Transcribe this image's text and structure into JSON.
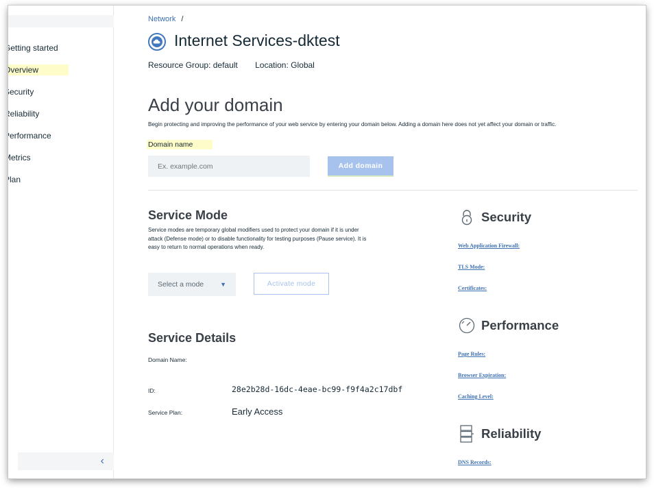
{
  "sidebar": {
    "items": [
      {
        "label": "Getting started"
      },
      {
        "label": "Overview"
      },
      {
        "label": "Security"
      },
      {
        "label": "Reliability"
      },
      {
        "label": "Performance"
      },
      {
        "label": "Metrics"
      },
      {
        "label": "Plan"
      }
    ],
    "active_index": 1,
    "collapse_glyph": "‹"
  },
  "breadcrumb": {
    "parent": "Network",
    "separator": "/"
  },
  "header": {
    "icon": "cloud-icon",
    "title": "Internet Services-dktest",
    "resource_group_label": "Resource Group:",
    "resource_group_value": "default",
    "location_label": "Location:",
    "location_value": "Global"
  },
  "add_domain": {
    "title": "Add your domain",
    "description": "Begin protecting and improving the performance of your web service by entering your domain below. Adding a domain here does not yet affect your domain or traffic.",
    "field_label": "Domain name",
    "placeholder": "Ex. example.com",
    "value": "",
    "button_label": "Add domain"
  },
  "service_mode": {
    "title": "Service Mode",
    "description": "Service modes are temporary global modifiers used to protect your domain if it is under attack (Defense mode) or to disable functionality for testing purposes (Pause service). It is easy to return to normal operations when ready.",
    "select_placeholder": "Select a mode",
    "activate_label": "Activate mode"
  },
  "service_details": {
    "title": "Service Details",
    "domain_name_label": "Domain Name:",
    "domain_name_value": "",
    "id_label": "ID:",
    "id_value": "28e2b28d-16dc-4eae-bc99-f9f4a2c17dbf",
    "plan_label": "Service Plan:",
    "plan_value": "Early Access"
  },
  "security": {
    "title": "Security",
    "icon": "lock-icon",
    "links": [
      "Web Application Firewall:",
      "TLS Mode:",
      "Certificates:"
    ]
  },
  "performance": {
    "title": "Performance",
    "icon": "speedometer-icon",
    "links": [
      "Page Rules:",
      "Browser Expiration:",
      "Caching Level:"
    ]
  },
  "reliability": {
    "title": "Reliability",
    "icon": "server-icon",
    "links": [
      "DNS Records:"
    ]
  },
  "colors": {
    "accent": "#3d70b2",
    "button_disabled": "#a7c2ec",
    "highlight": "#fefcc8",
    "input_bg": "#eff2f5"
  }
}
